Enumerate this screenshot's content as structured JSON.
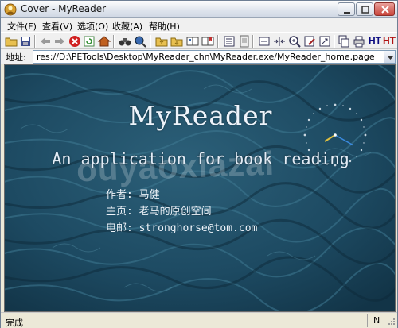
{
  "window": {
    "title": "Cover - MyReader"
  },
  "menu": [
    "文件(F)",
    "查看(V)",
    "选项(O)",
    "收藏(A)",
    "帮助(H)"
  ],
  "toolbar": {
    "text_buttons": [
      "HT",
      "HT"
    ]
  },
  "address": {
    "label": "地址:",
    "value": "res://D:\\PETools\\Desktop\\MyReader_chn\\MyReader.exe/MyReader_home.page"
  },
  "page": {
    "title": "MyReader",
    "subtitle": "An application for book reading",
    "author": "作者: 马健",
    "homepage": "主页: 老马的原创空间",
    "email": "电邮: stronghorse@tom.com",
    "watermark": "ouyaoxiazai"
  },
  "status": {
    "text": "完成",
    "indicator": "N"
  },
  "colors": {
    "content_bg": "#1f4a63",
    "title_bar": "#dde3ec",
    "toolbar_text": "#0a0a80"
  }
}
